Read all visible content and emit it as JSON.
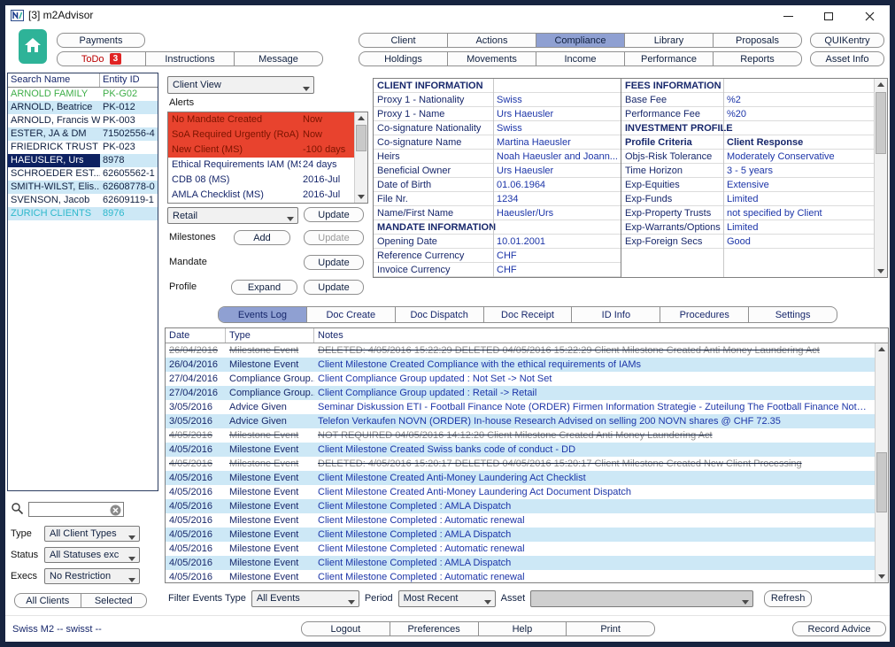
{
  "window": {
    "title": "[3] m2Advisor"
  },
  "statusbar": {
    "text": "Swiss M2 -- swisst --"
  },
  "toolbar": {
    "payments": "Payments",
    "todo_label": "ToDo",
    "todo_badge": "3",
    "instructions": "Instructions",
    "message": "Message",
    "quikentry": "QUIKentry",
    "asset_info": "Asset Info",
    "tabs_row1": [
      {
        "label": "Client",
        "active": false
      },
      {
        "label": "Actions",
        "active": false
      },
      {
        "label": "Compliance",
        "active": true
      },
      {
        "label": "Library",
        "active": false
      },
      {
        "label": "Proposals",
        "active": false
      }
    ],
    "tabs_row2": [
      {
        "label": "Holdings",
        "active": false
      },
      {
        "label": "Movements",
        "active": false
      },
      {
        "label": "Income",
        "active": false
      },
      {
        "label": "Performance",
        "active": false
      },
      {
        "label": "Reports",
        "active": false
      }
    ]
  },
  "client_list": {
    "col_name": "Search Name",
    "col_id": "Entity ID",
    "rows": [
      {
        "name": "ARNOLD FAMILY",
        "id": "PK-G02",
        "color": "green"
      },
      {
        "name": "ARNOLD, Beatrice",
        "id": "PK-012"
      },
      {
        "name": "ARNOLD, Francis W",
        "id": "PK-003"
      },
      {
        "name": "ESTER, JA & DM",
        "id": "71502556-4"
      },
      {
        "name": "FRIEDRICK TRUST",
        "id": "PK-023"
      },
      {
        "name": "HAEUSLER, Urs",
        "id": "8978",
        "selected": true
      },
      {
        "name": "SCHROEDER EST...",
        "id": "62605562-1"
      },
      {
        "name": "SMITH-WILST, Elis...",
        "id": "62608778-0"
      },
      {
        "name": "SVENSON, Jacob",
        "id": "62609119-1"
      },
      {
        "name": "ZURICH CLIENTS",
        "id": "8976",
        "color": "teal"
      }
    ]
  },
  "left_filters": {
    "search_value": "",
    "type_label": "Type",
    "type_value": "All Client Types",
    "status_label": "Status",
    "status_value": "All Statuses exc",
    "execs_label": "Execs",
    "execs_value": "No Restriction",
    "all_clients_label": "All Clients",
    "selected_label": "Selected"
  },
  "middle_panel": {
    "view_select": "Client View",
    "alerts_label": "Alerts",
    "alerts": [
      {
        "label": "No Mandate Created",
        "due": "Now",
        "urgent": true
      },
      {
        "label": "SoA Required Urgently (RoA)",
        "due": "Now",
        "urgent": true
      },
      {
        "label": "New Client (MS)",
        "due": "-100 days",
        "urgent": true
      },
      {
        "label": "Ethical Requirements IAM (MS)",
        "due": "24 days",
        "urgent": false
      },
      {
        "label": "CDB 08 (MS)",
        "due": "2016-Jul",
        "urgent": false
      },
      {
        "label": "AMLA Checklist (MS)",
        "due": "2016-Jul",
        "urgent": false
      }
    ],
    "retail_select": "Retail",
    "retail_update": "Update",
    "milestones_label": "Milestones",
    "milestones_add": "Add",
    "milestones_update": "Update",
    "mandate_label": "Mandate",
    "mandate_update": "Update",
    "profile_label": "Profile",
    "profile_expand": "Expand",
    "profile_update": "Update"
  },
  "client_info": {
    "left": [
      {
        "type": "header",
        "label": "CLIENT INFORMATION"
      },
      {
        "label": "Proxy 1 - Nationality",
        "value": "Swiss"
      },
      {
        "label": "Proxy 1 - Name",
        "value": "Urs Haeusler"
      },
      {
        "label": "Co-signature Nationality",
        "value": "Swiss"
      },
      {
        "label": "Co-signature Name",
        "value": "Martina Haeusler"
      },
      {
        "label": "Heirs",
        "value": "Noah Haeusler and Joann..."
      },
      {
        "label": "Beneficial Owner",
        "value": "Urs Haeusler"
      },
      {
        "label": "Date of Birth",
        "value": "01.06.1964"
      },
      {
        "label": "File Nr.",
        "value": "1234"
      },
      {
        "label": "Name/First Name",
        "value": "Haeusler/Urs"
      },
      {
        "type": "header",
        "label": "MANDATE INFORMATION"
      },
      {
        "label": "Opening Date",
        "value": "10.01.2001"
      },
      {
        "label": "Reference Currency",
        "value": "CHF"
      },
      {
        "label": "Invoice Currency",
        "value": "CHF"
      }
    ],
    "right": [
      {
        "type": "header",
        "label": "FEES INFORMATION"
      },
      {
        "label": "Base Fee",
        "value": "%2"
      },
      {
        "label": "Performance Fee",
        "value": "%20"
      },
      {
        "type": "header",
        "label": "INVESTMENT PROFILE"
      },
      {
        "type": "subheader",
        "label": "Profile Criteria",
        "value": "Client Response"
      },
      {
        "label": "Objs-Risk Tolerance",
        "value": "Moderately Conservative"
      },
      {
        "label": "Time Horizon",
        "value": "3 - 5 years"
      },
      {
        "label": "Exp-Equities",
        "value": "Extensive"
      },
      {
        "label": "Exp-Funds",
        "value": "Limited"
      },
      {
        "label": "Exp-Property Trusts",
        "value": "not specified by Client"
      },
      {
        "label": "Exp-Warrants/Options",
        "value": "Limited"
      },
      {
        "label": "Exp-Foreign Secs",
        "value": "Good"
      }
    ]
  },
  "doc_tabs": [
    {
      "label": "Events Log",
      "active": true
    },
    {
      "label": "Doc Create",
      "active": false
    },
    {
      "label": "Doc Dispatch",
      "active": false
    },
    {
      "label": "Doc Receipt",
      "active": false
    },
    {
      "label": "ID Info",
      "active": false
    },
    {
      "label": "Procedures",
      "active": false
    },
    {
      "label": "Settings",
      "active": false
    }
  ],
  "events": {
    "col_date": "Date",
    "col_type": "Type",
    "col_notes": "Notes",
    "rows": [
      {
        "date": "26/04/2016",
        "type": "Milestone Event",
        "notes": "DELETED: 4/05/2016 15:22:29 DELETED 04/05/2016 15:22:29 Client Milestone Created Anti Money Laundering Act",
        "struck": true
      },
      {
        "date": "26/04/2016",
        "type": "Milestone Event",
        "notes": "Client Milestone Created Compliance with the ethical requirements of IAMs"
      },
      {
        "date": "27/04/2016",
        "type": "Compliance Group...",
        "notes": "Client Compliance Group updated : Not Set -> Not Set"
      },
      {
        "date": "27/04/2016",
        "type": "Compliance Group...",
        "notes": "Client Compliance Group updated : Retail -> Retail"
      },
      {
        "date": "3/05/2016",
        "type": "Advice Given",
        "notes": "Seminar Diskussion ETI - Football Finance Note (ORDER) Firmen Information Strategie - Zuteilung The Football Finance Note finan..."
      },
      {
        "date": "3/05/2016",
        "type": "Advice Given",
        "notes": "Telefon Verkaufen NOVN (ORDER) In-house Research Advised on selling 200 NOVN shares @ CHF 72.35"
      },
      {
        "date": "4/05/2016",
        "type": "Milestone Event",
        "notes": "NOT REQUIRED 04/05/2016 14:12:20 Client Milestone Created Anti Money Laundering Act",
        "struck": true
      },
      {
        "date": "4/05/2016",
        "type": "Milestone Event",
        "notes": "Client Milestone Created Swiss banks code of conduct - DD"
      },
      {
        "date": "4/05/2016",
        "type": "Milestone Event",
        "notes": "DELETED: 4/05/2016 15:20:17 DELETED 04/05/2016 15:20:17 Client Milestone Created New Client Processing",
        "struck": true
      },
      {
        "date": "4/05/2016",
        "type": "Milestone Event",
        "notes": "Client Milestone Created Anti-Money Laundering Act Checklist"
      },
      {
        "date": "4/05/2016",
        "type": "Milestone Event",
        "notes": "Client Milestone Created Anti-Money Laundering Act Document Dispatch"
      },
      {
        "date": "4/05/2016",
        "type": "Milestone Event",
        "notes": "Client Milestone Completed : AMLA Dispatch"
      },
      {
        "date": "4/05/2016",
        "type": "Milestone Event",
        "notes": "Client Milestone Completed : Automatic renewal"
      },
      {
        "date": "4/05/2016",
        "type": "Milestone Event",
        "notes": "Client Milestone Completed : AMLA Dispatch"
      },
      {
        "date": "4/05/2016",
        "type": "Milestone Event",
        "notes": "Client Milestone Completed : Automatic renewal"
      },
      {
        "date": "4/05/2016",
        "type": "Milestone Event",
        "notes": "Client Milestone Completed : AMLA Dispatch"
      },
      {
        "date": "4/05/2016",
        "type": "Milestone Event",
        "notes": "Client Milestone Completed : Automatic renewal"
      }
    ]
  },
  "bottom_filter": {
    "filter_label": "Filter Events Type",
    "filter_value": "All Events",
    "period_label": "Period",
    "period_value": "Most Recent",
    "asset_label": "Asset",
    "asset_value": "",
    "refresh": "Refresh"
  },
  "footer": {
    "buttons": [
      "Logout",
      "Preferences",
      "Help",
      "Print"
    ],
    "record_advice": "Record Advice"
  },
  "colors": {
    "accent_tab": "#8fa0d2",
    "alert_red": "#e8432e",
    "selected_row": "#0d2161",
    "row_alt_blue": "#cde8f6",
    "home_teal": "#2eb398"
  }
}
